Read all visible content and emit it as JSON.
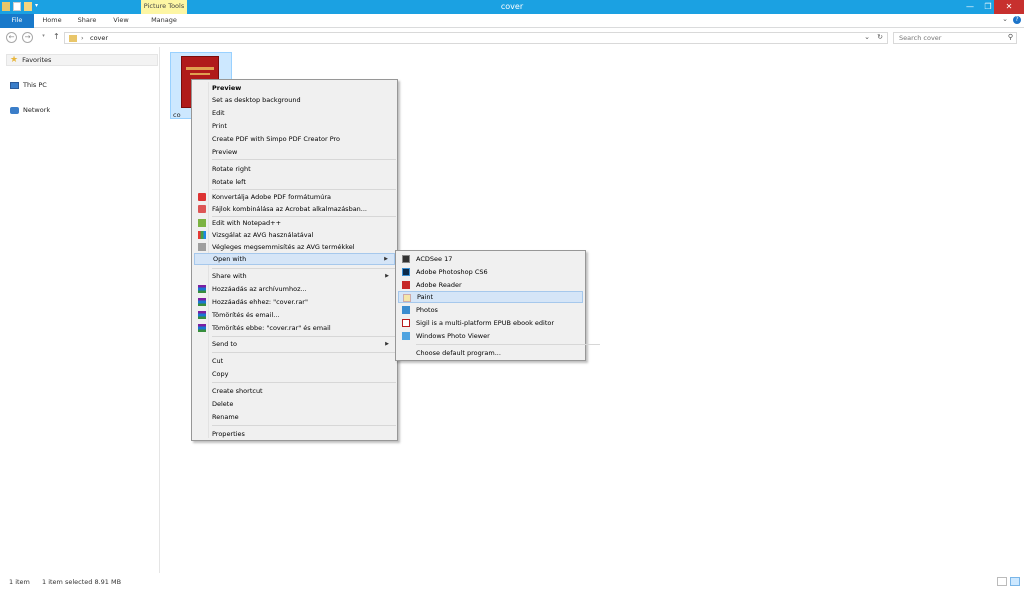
{
  "window": {
    "title": "cover",
    "context_tab": "Picture Tools",
    "controls": {
      "minimize": "—",
      "maximize": "❐",
      "close": "✕"
    }
  },
  "ribbon": {
    "tabs": [
      "File",
      "Home",
      "Share",
      "View",
      "Manage"
    ],
    "help": "?"
  },
  "address_bar": {
    "back": "←",
    "forward": "→",
    "up": "↑",
    "separator": "›",
    "path": "cover",
    "search_placeholder": "Search cover"
  },
  "nav_pane": {
    "items": [
      "Favorites",
      "This PC",
      "Network"
    ]
  },
  "content": {
    "file_label": "co"
  },
  "context_menu": {
    "items": [
      "Preview",
      "Set as desktop background",
      "Edit",
      "Print",
      "Create PDF with Simpo PDF Creator Pro",
      "Preview",
      "Rotate right",
      "Rotate left",
      "Konvertálja Adobe PDF formátumúra",
      "Fájlok kombinálása az Acrobat alkalmazásban...",
      "Edit with Notepad++",
      "Vizsgálat az AVG használatával",
      "Végleges megsemmisítés az AVG termékkel",
      "Open with",
      "Share with",
      "Hozzáadás az archívumhoz...",
      "Hozzáadás ehhez: \"cover.rar\"",
      "Tömörítés és email...",
      "Tömörítés ebbe: \"cover.rar\" és email",
      "Send to",
      "Cut",
      "Copy",
      "Create shortcut",
      "Delete",
      "Rename",
      "Properties"
    ]
  },
  "open_with_menu": {
    "items": [
      "ACDSee 17",
      "Adobe Photoshop CS6",
      "Adobe Reader",
      "Paint",
      "Photos",
      "Sigil is a multi-platform EPUB ebook editor",
      "Windows Photo Viewer",
      "Choose default program..."
    ]
  },
  "status_bar": {
    "count": "1 item",
    "selection": "1 item selected  8.91 MB"
  },
  "colors": {
    "titlebar": "#1ba1e2",
    "file_tab": "#1979ca",
    "picture_tools": "#fdf6a4",
    "selection": "#cde8ff",
    "menu_highlight": "#d5e5f7"
  }
}
